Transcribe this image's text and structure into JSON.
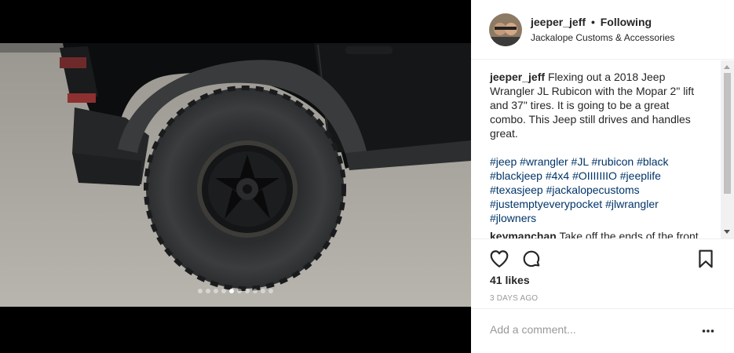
{
  "post": {
    "username": "jeeper_jeff",
    "separator": "•",
    "follow_status": "Following",
    "location": "Jackalope Customs & Accessories",
    "caption": {
      "username": "jeeper_jeff",
      "text": "Flexing out a 2018 Jeep Wrangler JL Rubicon with the Mopar 2\" lift and 37\" tires. It is going to be a great combo. This Jeep still drives and handles great.",
      "hashtags": [
        "#jeep",
        "#wrangler",
        "#JL",
        "#rubicon",
        "#black",
        "#blackjeep",
        "#4x4",
        "#OIIIIIIIO",
        "#jeeplife",
        "#texasjeep",
        "#jackalopecustoms",
        "#justemptyeverypocket",
        "#jlwrangler",
        "#jlowners"
      ]
    },
    "next_comment": {
      "username": "keymanchan",
      "text": "Take off the ends of the front"
    },
    "likes": "41 likes",
    "timestamp": "3 DAYS AGO",
    "comment_placeholder": "Add a comment..."
  },
  "carousel": {
    "count": 10,
    "active_index": 4
  },
  "icons": {
    "like": "heart-icon",
    "comment": "comment-icon",
    "save": "bookmark-icon",
    "more": "more-options-icon"
  },
  "colors": {
    "text": "#262626",
    "hashtag": "#003569",
    "muted": "#999999"
  }
}
